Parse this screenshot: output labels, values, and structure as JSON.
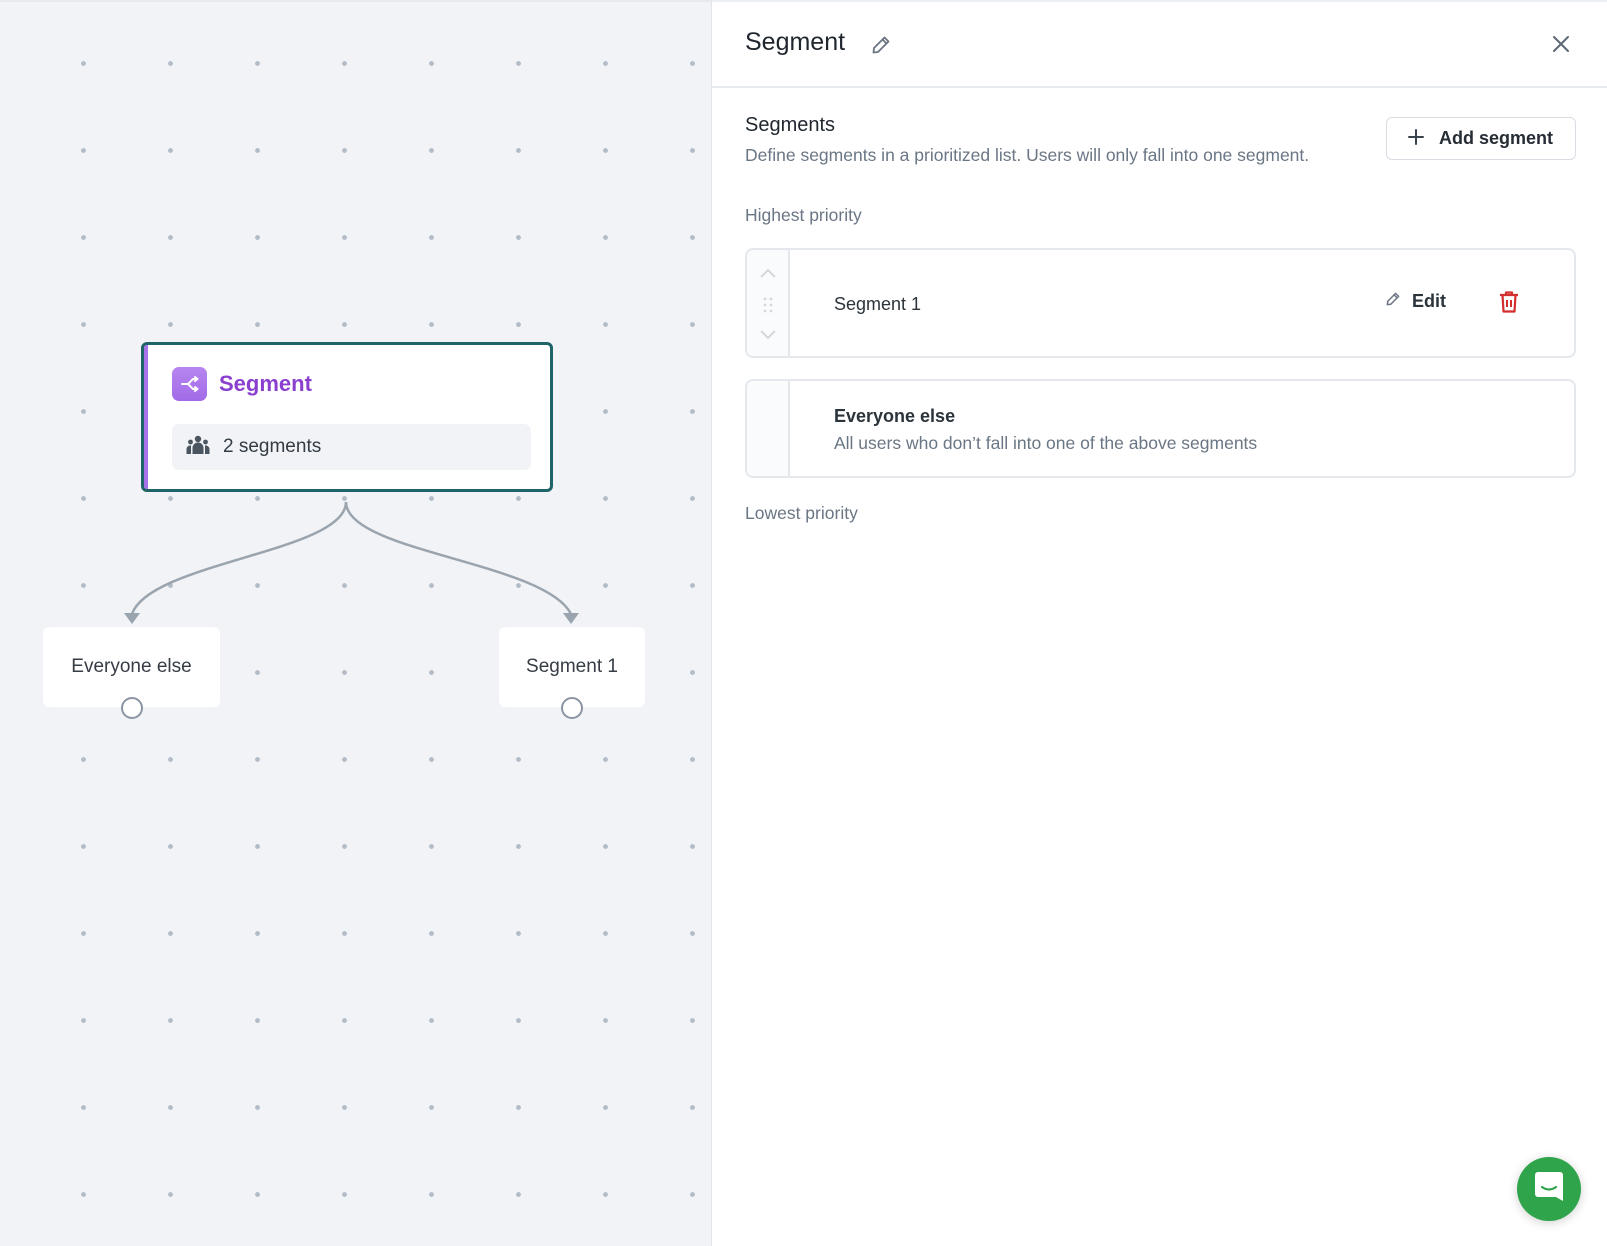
{
  "canvas": {
    "segment_node": {
      "title": "Segment",
      "count_label": "2 segments",
      "accent_color": "#a26ae8",
      "border_color": "#1f6468"
    },
    "branches": [
      {
        "label": "Everyone else"
      },
      {
        "label": "Segment 1"
      }
    ]
  },
  "panel": {
    "title": "Segment",
    "section_title": "Segments",
    "section_description": "Define segments in a prioritized list. Users will only fall into one segment.",
    "add_button_label": "Add segment",
    "highest_priority_label": "Highest priority",
    "lowest_priority_label": "Lowest priority",
    "segments": [
      {
        "name": "Segment 1",
        "edit_label": "Edit"
      }
    ],
    "fallback": {
      "name": "Everyone else",
      "description": "All users who don’t fall into one of the above segments"
    },
    "delete_color": "#d32f2f"
  },
  "chat_widget": {
    "color": "#2fa44a"
  }
}
